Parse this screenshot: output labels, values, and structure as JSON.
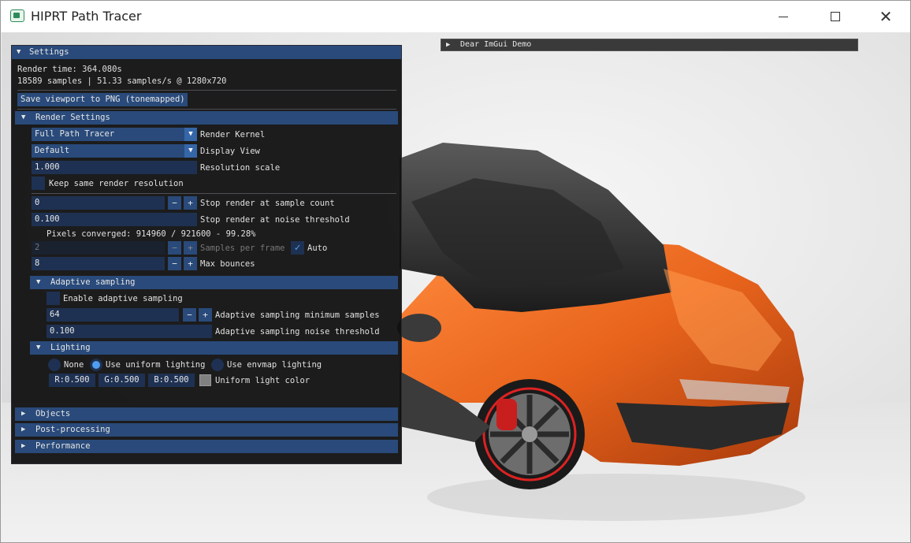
{
  "window": {
    "title": "HIPRT Path Tracer"
  },
  "demo_window": {
    "title": "Dear ImGui Demo"
  },
  "settings": {
    "title": "Settings",
    "render_time": "Render time: 364.080s",
    "samples_info": "18589 samples | 51.33 samples/s @ 1280x720",
    "save_button": "Save viewport to PNG (tonemapped)",
    "render_settings": {
      "title": "Render Settings",
      "render_kernel_value": "Full Path Tracer",
      "render_kernel_label": "Render Kernel",
      "display_view_value": "Default",
      "display_view_label": "Display View",
      "resolution_scale_value": "1.000",
      "resolution_scale_label": "Resolution scale",
      "keep_resolution_label": "Keep same render resolution",
      "stop_sample_value": "0",
      "stop_sample_label": "Stop render at sample count",
      "stop_noise_value": "0.100",
      "stop_noise_label": "Stop render at noise threshold",
      "pixels_converged": "Pixels converged: 914960 / 921600 - 99.28%",
      "samples_per_frame_value": "2",
      "samples_per_frame_label": "Samples per frame",
      "auto_label": "Auto",
      "max_bounces_value": "8",
      "max_bounces_label": "Max bounces",
      "minus": "−",
      "plus": "+"
    },
    "adaptive": {
      "title": "Adaptive sampling",
      "enable_label": "Enable adaptive sampling",
      "min_samples_value": "64",
      "min_samples_label": "Adaptive sampling minimum samples",
      "noise_value": "0.100",
      "noise_label": "Adaptive sampling noise threshold"
    },
    "lighting": {
      "title": "Lighting",
      "none_label": "None",
      "uniform_label": "Use uniform lighting",
      "envmap_label": "Use envmap lighting",
      "r_value": "R:0.500",
      "g_value": "G:0.500",
      "b_value": "B:0.500",
      "color_label": "Uniform light color"
    },
    "sections": {
      "objects": "Objects",
      "post_processing": "Post-processing",
      "performance": "Performance"
    }
  },
  "icons": {
    "expanded": "▼",
    "collapsed": "▶",
    "check": "✓"
  },
  "colors": {
    "header": "#294a7a",
    "frame": "#1e3152",
    "accent": "#4f9ef0",
    "car_orange": "#e8641c"
  }
}
